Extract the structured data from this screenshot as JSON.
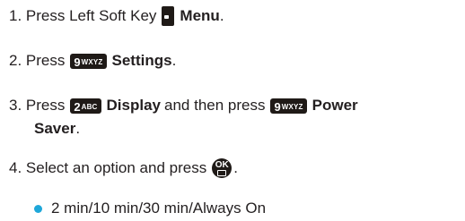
{
  "steps": {
    "s1": {
      "pre": "1. Press Left Soft Key",
      "bold": "Menu",
      "post": "."
    },
    "s2": {
      "pre": "2. Press",
      "key": {
        "num": "9",
        "sub": "WXYZ"
      },
      "bold": "Settings",
      "post": "."
    },
    "s3": {
      "pre": "3. Press",
      "key1": {
        "num": "2",
        "sub": "ABC"
      },
      "bold1": "Display",
      "mid": "and then press",
      "key2": {
        "num": "9",
        "sub": "WXYZ"
      },
      "bold2": "Power",
      "bold2_cont": "Saver",
      "post": "."
    },
    "s4": {
      "pre": "4. Select an option and press",
      "ok_label": "OK",
      "post": "."
    }
  },
  "options": {
    "text": "2 min/10 min/30 min/Always On"
  },
  "colors": {
    "text": "#231f20",
    "key_bg": "#1f1a17",
    "bullet": "#1ea7d9"
  },
  "icons": {
    "softkey": "left-soft-key-icon",
    "ok": "ok-camera-key-icon"
  }
}
